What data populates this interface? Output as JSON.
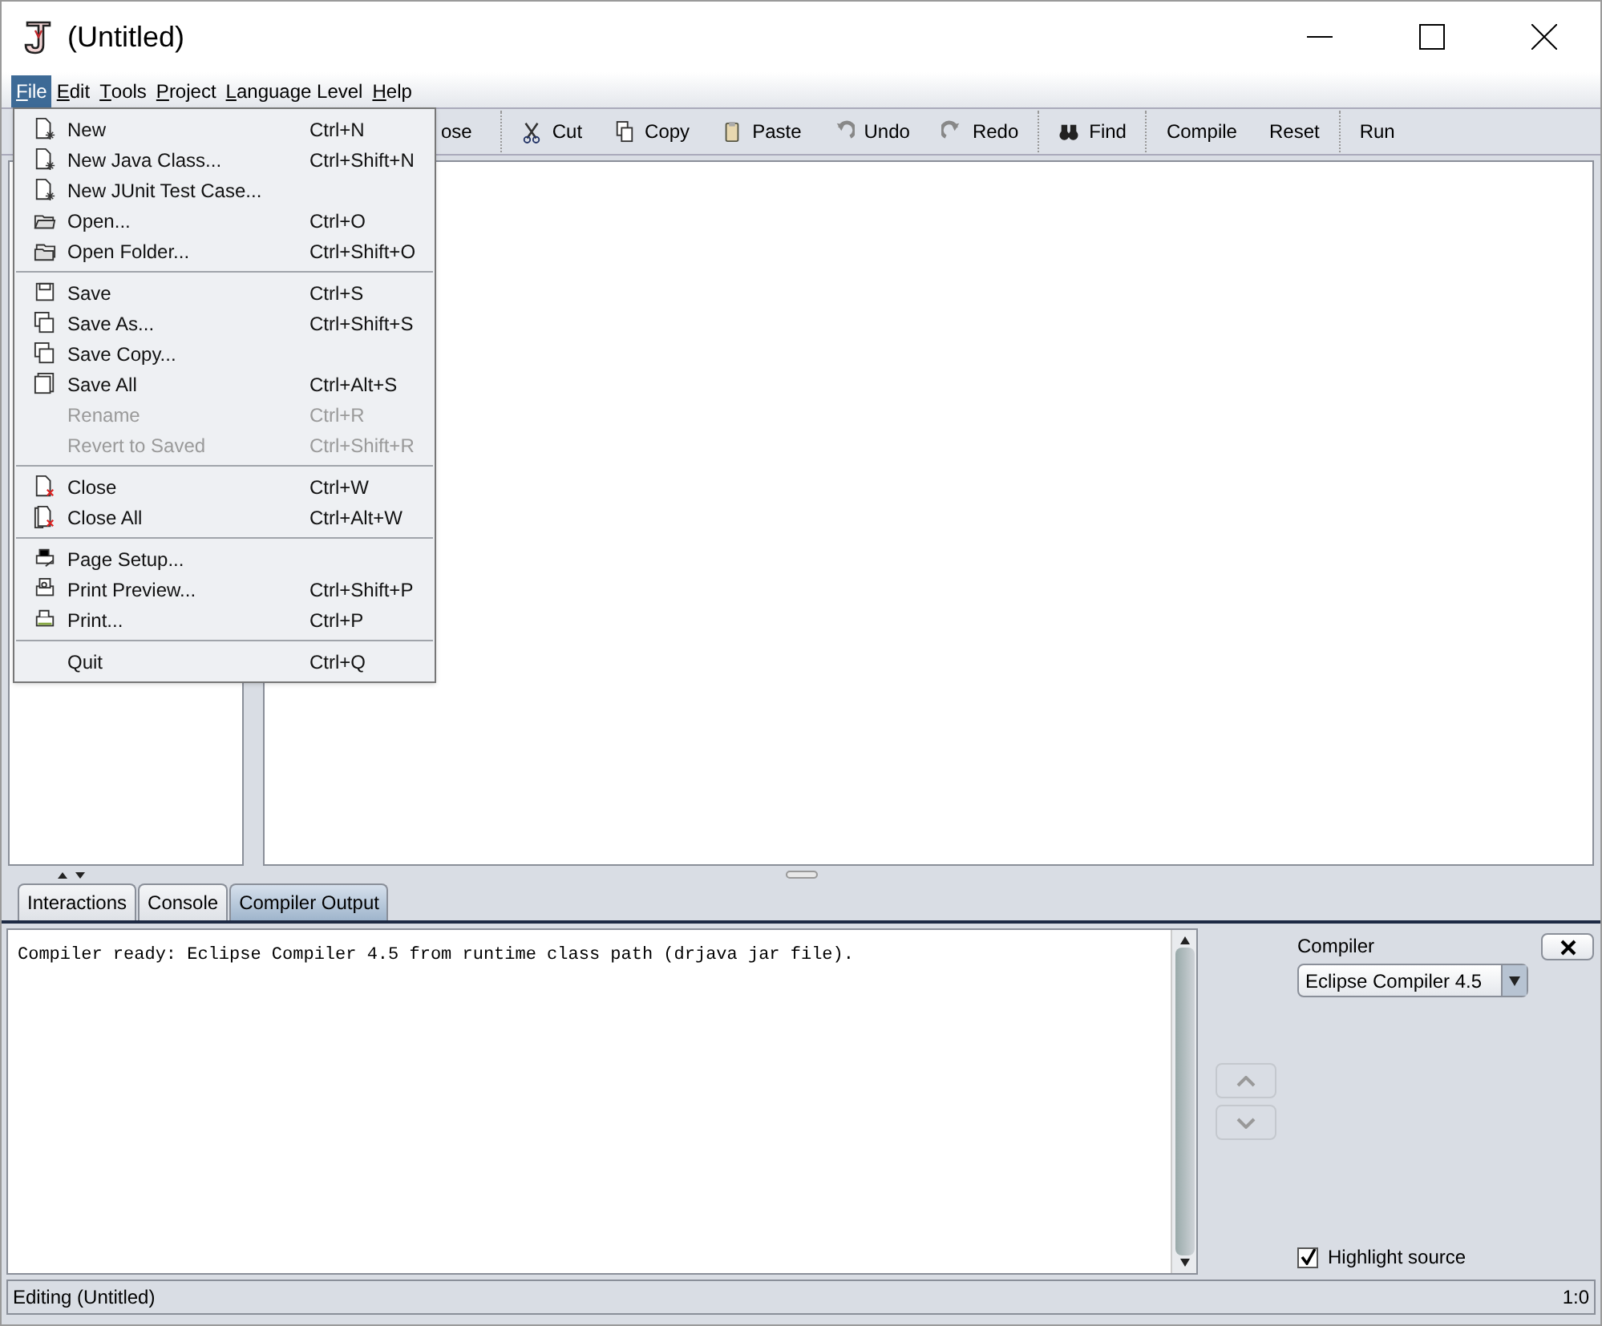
{
  "window": {
    "title": "(Untitled)"
  },
  "menubar": [
    {
      "label": "File",
      "selected": true
    },
    {
      "label": "Edit",
      "selected": false
    },
    {
      "label": "Tools",
      "selected": false
    },
    {
      "label": "Project",
      "selected": false
    },
    {
      "label": "Language Level",
      "selected": false
    },
    {
      "label": "Help",
      "selected": false
    }
  ],
  "toolbar": [
    {
      "label": "ose"
    },
    {
      "label": "Cut"
    },
    {
      "label": "Copy"
    },
    {
      "label": "Paste"
    },
    {
      "label": "Undo"
    },
    {
      "label": "Redo"
    },
    {
      "label": "Find"
    },
    {
      "label": "Compile"
    },
    {
      "label": "Reset"
    },
    {
      "label": "Run"
    }
  ],
  "file_menu": [
    [
      {
        "label": "New",
        "shortcut": "Ctrl+N",
        "disabled": false
      },
      {
        "label": "New Java Class...",
        "shortcut": "Ctrl+Shift+N",
        "disabled": false
      },
      {
        "label": "New JUnit Test Case...",
        "disabled": false
      },
      {
        "label": "Open...",
        "shortcut": "Ctrl+O",
        "disabled": false
      },
      {
        "label": "Open Folder...",
        "shortcut": "Ctrl+Shift+O",
        "disabled": false
      }
    ],
    [
      {
        "label": "Save",
        "shortcut": "Ctrl+S",
        "disabled": false
      },
      {
        "label": "Save As...",
        "shortcut": "Ctrl+Shift+S",
        "disabled": false
      },
      {
        "label": "Save Copy...",
        "disabled": false
      },
      {
        "label": "Save All",
        "shortcut": "Ctrl+Alt+S",
        "disabled": false
      },
      {
        "label": "Rename",
        "shortcut": "Ctrl+R",
        "disabled": true
      },
      {
        "label": "Revert to Saved",
        "shortcut": "Ctrl+Shift+R",
        "disabled": true
      }
    ],
    [
      {
        "label": "Close",
        "shortcut": "Ctrl+W",
        "disabled": false
      },
      {
        "label": "Close All",
        "shortcut": "Ctrl+Alt+W",
        "disabled": false
      }
    ],
    [
      {
        "label": "Page Setup...",
        "disabled": false
      },
      {
        "label": "Print Preview...",
        "shortcut": "Ctrl+Shift+P",
        "disabled": false
      },
      {
        "label": "Print...",
        "shortcut": "Ctrl+P",
        "disabled": false
      }
    ],
    [
      {
        "label": "Quit",
        "shortcut": "Ctrl+Q",
        "disabled": false
      }
    ]
  ],
  "bottom_tabs": [
    {
      "label": "Interactions",
      "selected": false
    },
    {
      "label": "Console",
      "selected": false
    },
    {
      "label": "Compiler Output",
      "selected": true
    }
  ],
  "output": "Compiler ready: Eclipse Compiler 4.5 from runtime class path (drjava jar file).",
  "compiler": {
    "label": "Compiler",
    "value": "Eclipse Compiler 4.5"
  },
  "highlight_source": {
    "label": "Highlight source",
    "checked": true
  },
  "status_bar": {
    "left": "Editing (Untitled)",
    "right": "1:0"
  }
}
